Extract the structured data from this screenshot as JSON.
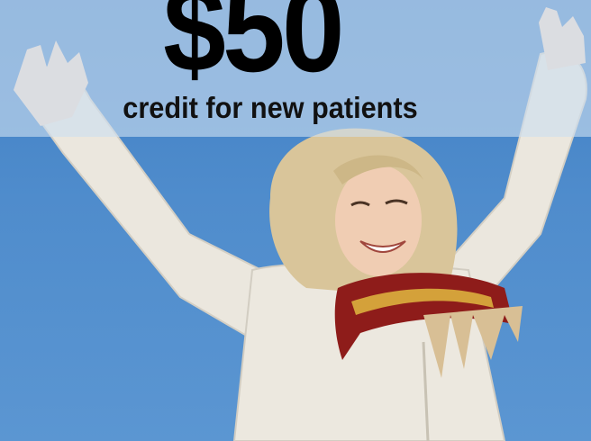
{
  "promo": {
    "amount": "$50",
    "subtitle": "credit for new patients"
  },
  "colors": {
    "sky": "#4b86c6",
    "overlay": "#cddef0",
    "text": "#000000",
    "sweater": "#ece8df",
    "scarf_red": "#8e1c1a",
    "hair": "#d9c59a"
  }
}
